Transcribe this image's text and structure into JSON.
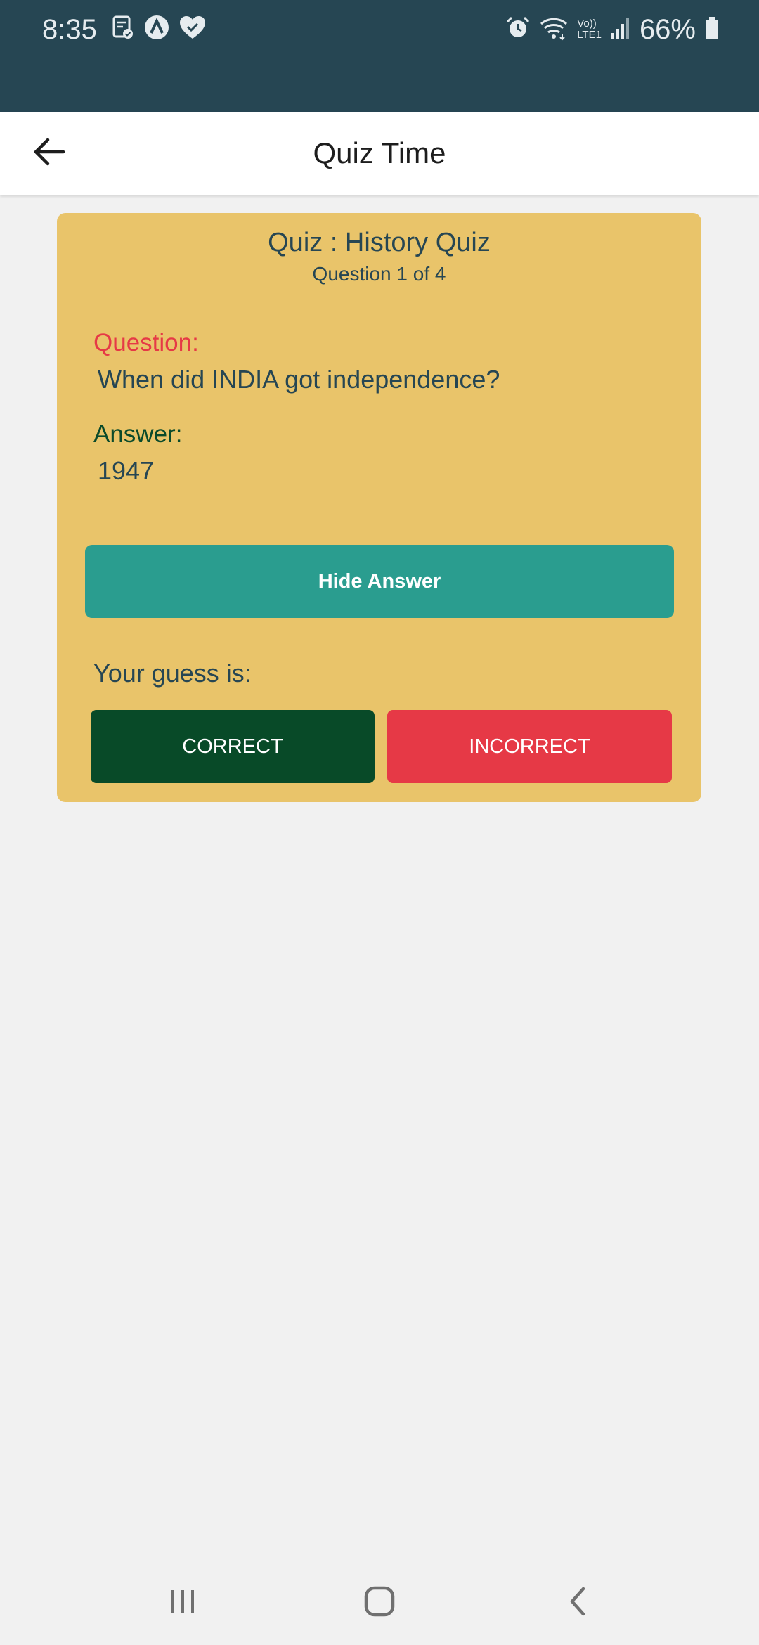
{
  "status_bar": {
    "time": "8:35",
    "battery": "66%",
    "left_icons": [
      "clipboard-check-icon",
      "a-circle-icon",
      "heart-check-icon"
    ],
    "right_icons": [
      "alarm-icon",
      "wifi-icon",
      "volte-lte1-icon",
      "signal-icon",
      "battery-icon"
    ],
    "network_label_top": "Vo))",
    "network_label_bottom": "LTE1"
  },
  "app_bar": {
    "title": "Quiz Time",
    "back_icon": "arrow-left-icon"
  },
  "quiz": {
    "title": "Quiz : History Quiz",
    "progress": "Question 1 of 4",
    "question_label": "Question:",
    "question_text": "When did INDIA got independence?",
    "answer_label": "Answer:",
    "answer_text": "1947",
    "hide_answer_label": "Hide Answer",
    "guess_label": "Your guess is:",
    "correct_label": "CORRECT",
    "incorrect_label": "INCORRECT"
  },
  "colors": {
    "status_bar": "#264653",
    "card": "#e9c46a",
    "hide_button": "#2a9d8f",
    "correct_button": "#084a28",
    "incorrect_button": "#e63946",
    "question_label": "#e63946",
    "answer_label": "#0a4a2a",
    "text": "#264653"
  },
  "nav_bar": {
    "icons": [
      "recent-apps-icon",
      "home-icon",
      "back-icon"
    ]
  }
}
